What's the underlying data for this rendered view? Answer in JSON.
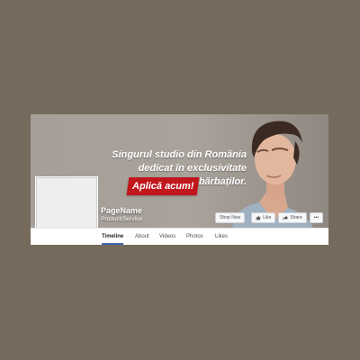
{
  "cover": {
    "tagline_line1": "Singurul studio din România",
    "tagline_line2": "dedicat în exclusivitate bărbaților.",
    "cta_label": "Aplică acum!"
  },
  "page": {
    "name": "PageName",
    "category": "Product/Service"
  },
  "actions": {
    "shop_now": "Shop Now",
    "like": "Like",
    "share": "Share",
    "more": "•••"
  },
  "tabs": [
    {
      "label": "Timeline",
      "active": true
    },
    {
      "label": "About"
    },
    {
      "label": "Videos"
    },
    {
      "label": "Photos"
    },
    {
      "label": "Likes"
    }
  ],
  "colors": {
    "background": "#756a5c",
    "cta": "#c0161c",
    "tab_accent": "#4267b2"
  },
  "icons": [
    "like-thumb-icon",
    "share-arrow-icon",
    "more-dots-icon"
  ]
}
